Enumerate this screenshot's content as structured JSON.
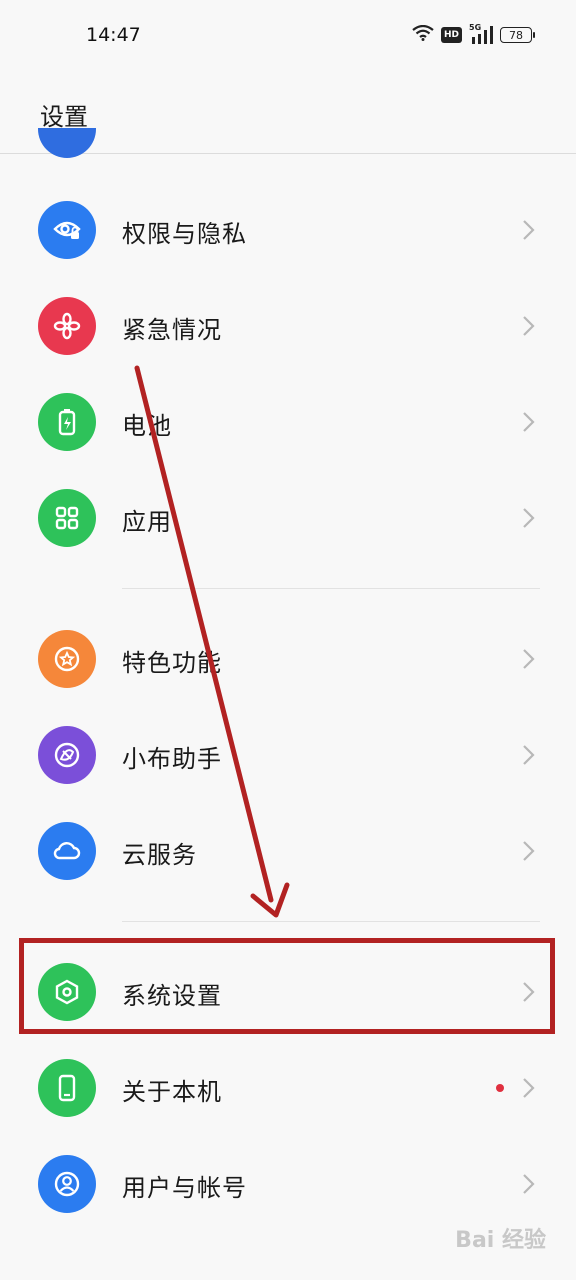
{
  "status_bar": {
    "time": "14:47",
    "hd_label": "HD",
    "network_label": "5G",
    "battery_level": "78"
  },
  "header": {
    "title": "设置"
  },
  "settings_items": [
    {
      "label": "权限与隐私",
      "icon": "eye-lock-icon",
      "color": "#2b7cf0"
    },
    {
      "label": "紧急情况",
      "icon": "asterisk-icon",
      "color": "#e8384f"
    },
    {
      "label": "电池",
      "icon": "battery-icon",
      "color": "#2ec25a"
    },
    {
      "label": "应用",
      "icon": "apps-grid-icon",
      "color": "#2ec25a"
    },
    {
      "label": "特色功能",
      "icon": "star-icon",
      "color": "#f5873a"
    },
    {
      "label": "小布助手",
      "icon": "assistant-icon",
      "color": "#7b4fd9"
    },
    {
      "label": "云服务",
      "icon": "cloud-icon",
      "color": "#2b7cf0"
    },
    {
      "label": "系统设置",
      "icon": "hexagon-gear-icon",
      "color": "#2ec25a"
    },
    {
      "label": "关于本机",
      "icon": "phone-icon",
      "color": "#2ec25a"
    },
    {
      "label": "用户与帐号",
      "icon": "user-icon",
      "color": "#2b7cf0"
    }
  ],
  "accent_colors": {
    "annotation_red": "#b22222",
    "notification_dot": "#e0303f"
  },
  "watermark": "Bai 经验"
}
